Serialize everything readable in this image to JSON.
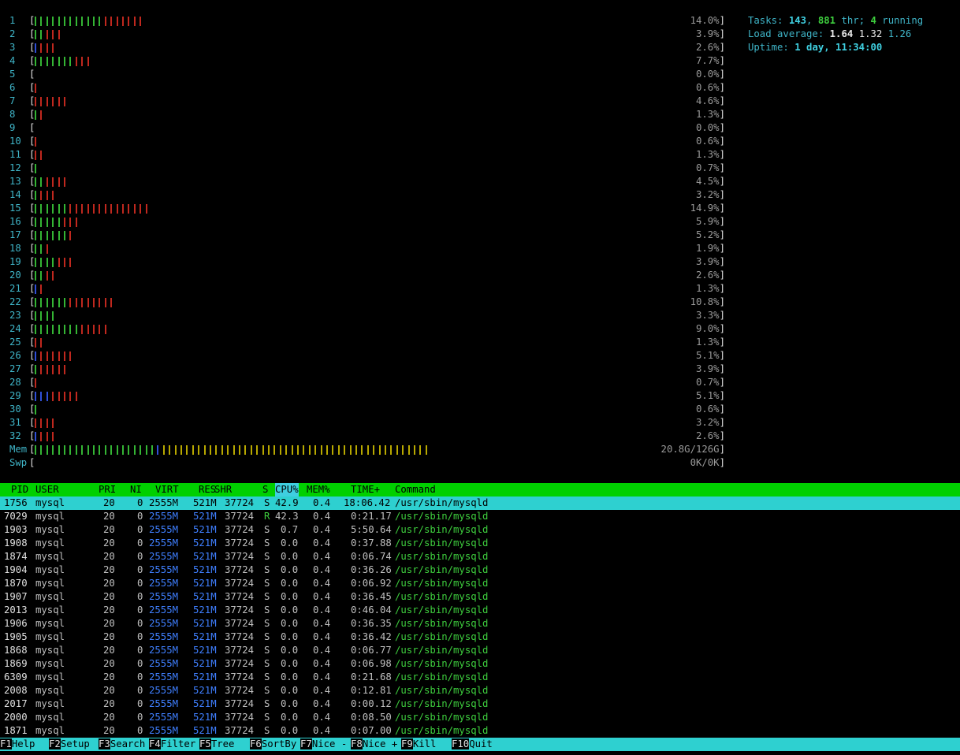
{
  "colors": {
    "normal_bar": "#34b534",
    "kernel_bar": "#c0281e",
    "low_bar": "#3050d8",
    "buffer_bar": "#b8a800",
    "accent": "#2ed0d0",
    "header_bg": "#00d000"
  },
  "meters": {
    "cpus": [
      {
        "id": "1",
        "percent": "14.0%",
        "segments": [
          [
            "g",
            12
          ],
          [
            "r",
            7
          ]
        ]
      },
      {
        "id": "2",
        "percent": "3.9%",
        "segments": [
          [
            "g",
            2
          ],
          [
            "r",
            3
          ]
        ]
      },
      {
        "id": "3",
        "percent": "2.6%",
        "segments": [
          [
            "b",
            1
          ],
          [
            "r",
            3
          ]
        ]
      },
      {
        "id": "4",
        "percent": "7.7%",
        "segments": [
          [
            "g",
            7
          ],
          [
            "r",
            3
          ]
        ]
      },
      {
        "id": "5",
        "percent": "0.0%",
        "segments": []
      },
      {
        "id": "6",
        "percent": "0.6%",
        "segments": [
          [
            "r",
            1
          ]
        ]
      },
      {
        "id": "7",
        "percent": "4.6%",
        "segments": [
          [
            "r",
            6
          ]
        ]
      },
      {
        "id": "8",
        "percent": "1.3%",
        "segments": [
          [
            "g",
            1
          ],
          [
            "r",
            1
          ]
        ]
      },
      {
        "id": "9",
        "percent": "0.0%",
        "segments": []
      },
      {
        "id": "10",
        "percent": "0.6%",
        "segments": [
          [
            "r",
            1
          ]
        ]
      },
      {
        "id": "11",
        "percent": "1.3%",
        "segments": [
          [
            "r",
            2
          ]
        ]
      },
      {
        "id": "12",
        "percent": "0.7%",
        "segments": [
          [
            "g",
            1
          ]
        ]
      },
      {
        "id": "13",
        "percent": "4.5%",
        "segments": [
          [
            "g",
            2
          ],
          [
            "r",
            4
          ]
        ]
      },
      {
        "id": "14",
        "percent": "3.2%",
        "segments": [
          [
            "g",
            1
          ],
          [
            "r",
            3
          ]
        ]
      },
      {
        "id": "15",
        "percent": "14.9%",
        "segments": [
          [
            "g",
            6
          ],
          [
            "r",
            14
          ]
        ]
      },
      {
        "id": "16",
        "percent": "5.9%",
        "segments": [
          [
            "g",
            5
          ],
          [
            "r",
            3
          ]
        ]
      },
      {
        "id": "17",
        "percent": "5.2%",
        "segments": [
          [
            "g",
            6
          ],
          [
            "r",
            1
          ]
        ]
      },
      {
        "id": "18",
        "percent": "1.9%",
        "segments": [
          [
            "g",
            2
          ],
          [
            "r",
            1
          ]
        ]
      },
      {
        "id": "19",
        "percent": "3.9%",
        "segments": [
          [
            "g",
            4
          ],
          [
            "r",
            3
          ]
        ]
      },
      {
        "id": "20",
        "percent": "2.6%",
        "segments": [
          [
            "g",
            2
          ],
          [
            "r",
            2
          ]
        ]
      },
      {
        "id": "21",
        "percent": "1.3%",
        "segments": [
          [
            "b",
            1
          ],
          [
            "r",
            1
          ]
        ]
      },
      {
        "id": "22",
        "percent": "10.8%",
        "segments": [
          [
            "g",
            6
          ],
          [
            "r",
            8
          ]
        ]
      },
      {
        "id": "23",
        "percent": "3.3%",
        "segments": [
          [
            "g",
            4
          ]
        ]
      },
      {
        "id": "24",
        "percent": "9.0%",
        "segments": [
          [
            "g",
            8
          ],
          [
            "r",
            5
          ]
        ]
      },
      {
        "id": "25",
        "percent": "1.3%",
        "segments": [
          [
            "r",
            2
          ]
        ]
      },
      {
        "id": "26",
        "percent": "5.1%",
        "segments": [
          [
            "b",
            1
          ],
          [
            "r",
            6
          ]
        ]
      },
      {
        "id": "27",
        "percent": "3.9%",
        "segments": [
          [
            "g",
            1
          ],
          [
            "r",
            5
          ]
        ]
      },
      {
        "id": "28",
        "percent": "0.7%",
        "segments": [
          [
            "r",
            1
          ]
        ]
      },
      {
        "id": "29",
        "percent": "5.1%",
        "segments": [
          [
            "b",
            3
          ],
          [
            "r",
            5
          ]
        ]
      },
      {
        "id": "30",
        "percent": "0.6%",
        "segments": [
          [
            "g",
            1
          ]
        ]
      },
      {
        "id": "31",
        "percent": "3.2%",
        "segments": [
          [
            "r",
            4
          ]
        ]
      },
      {
        "id": "32",
        "percent": "2.6%",
        "segments": [
          [
            "b",
            1
          ],
          [
            "r",
            3
          ]
        ]
      }
    ],
    "mem": {
      "label": "Mem",
      "value": "20.8G/126G",
      "segments": [
        [
          "g",
          21
        ],
        [
          "b",
          1
        ],
        [
          "y",
          46
        ]
      ]
    },
    "swap": {
      "label": "Swp",
      "value": "0K/0K",
      "segments": []
    }
  },
  "summary": {
    "tasks_label": "Tasks: ",
    "tasks": "143",
    "sep1": ", ",
    "threads": "881",
    "thr_label": " thr; ",
    "running": "4",
    "running_label": " running",
    "load_label": "Load average: ",
    "load1": "1.64",
    "load5": "1.32",
    "load15": "1.26",
    "uptime_label": "Uptime: ",
    "uptime": "1 day, 11:34:00"
  },
  "table": {
    "columns": [
      "PID",
      "USER",
      "PRI",
      "NI",
      "VIRT",
      "RES",
      "SHR",
      "S",
      "CPU%",
      "MEM%",
      "TIME+",
      "Command"
    ],
    "rows": [
      [
        "1756",
        "mysql",
        "20",
        "0",
        "2555M",
        "521M",
        "37724",
        "S",
        "42.9",
        "0.4",
        "18:06.42",
        "/usr/sbin/mysqld"
      ],
      [
        "7029",
        "mysql",
        "20",
        "0",
        "2555M",
        "521M",
        "37724",
        "R",
        "42.3",
        "0.4",
        "0:21.17",
        "/usr/sbin/mysqld"
      ],
      [
        "1903",
        "mysql",
        "20",
        "0",
        "2555M",
        "521M",
        "37724",
        "S",
        "0.7",
        "0.4",
        "5:50.64",
        "/usr/sbin/mysqld"
      ],
      [
        "1908",
        "mysql",
        "20",
        "0",
        "2555M",
        "521M",
        "37724",
        "S",
        "0.0",
        "0.4",
        "0:37.88",
        "/usr/sbin/mysqld"
      ],
      [
        "1874",
        "mysql",
        "20",
        "0",
        "2555M",
        "521M",
        "37724",
        "S",
        "0.0",
        "0.4",
        "0:06.74",
        "/usr/sbin/mysqld"
      ],
      [
        "1904",
        "mysql",
        "20",
        "0",
        "2555M",
        "521M",
        "37724",
        "S",
        "0.0",
        "0.4",
        "0:36.26",
        "/usr/sbin/mysqld"
      ],
      [
        "1870",
        "mysql",
        "20",
        "0",
        "2555M",
        "521M",
        "37724",
        "S",
        "0.0",
        "0.4",
        "0:06.92",
        "/usr/sbin/mysqld"
      ],
      [
        "1907",
        "mysql",
        "20",
        "0",
        "2555M",
        "521M",
        "37724",
        "S",
        "0.0",
        "0.4",
        "0:36.45",
        "/usr/sbin/mysqld"
      ],
      [
        "2013",
        "mysql",
        "20",
        "0",
        "2555M",
        "521M",
        "37724",
        "S",
        "0.0",
        "0.4",
        "0:46.04",
        "/usr/sbin/mysqld"
      ],
      [
        "1906",
        "mysql",
        "20",
        "0",
        "2555M",
        "521M",
        "37724",
        "S",
        "0.0",
        "0.4",
        "0:36.35",
        "/usr/sbin/mysqld"
      ],
      [
        "1905",
        "mysql",
        "20",
        "0",
        "2555M",
        "521M",
        "37724",
        "S",
        "0.0",
        "0.4",
        "0:36.42",
        "/usr/sbin/mysqld"
      ],
      [
        "1868",
        "mysql",
        "20",
        "0",
        "2555M",
        "521M",
        "37724",
        "S",
        "0.0",
        "0.4",
        "0:06.77",
        "/usr/sbin/mysqld"
      ],
      [
        "1869",
        "mysql",
        "20",
        "0",
        "2555M",
        "521M",
        "37724",
        "S",
        "0.0",
        "0.4",
        "0:06.98",
        "/usr/sbin/mysqld"
      ],
      [
        "6309",
        "mysql",
        "20",
        "0",
        "2555M",
        "521M",
        "37724",
        "S",
        "0.0",
        "0.4",
        "0:21.68",
        "/usr/sbin/mysqld"
      ],
      [
        "2008",
        "mysql",
        "20",
        "0",
        "2555M",
        "521M",
        "37724",
        "S",
        "0.0",
        "0.4",
        "0:12.81",
        "/usr/sbin/mysqld"
      ],
      [
        "2017",
        "mysql",
        "20",
        "0",
        "2555M",
        "521M",
        "37724",
        "S",
        "0.0",
        "0.4",
        "0:00.12",
        "/usr/sbin/mysqld"
      ],
      [
        "2000",
        "mysql",
        "20",
        "0",
        "2555M",
        "521M",
        "37724",
        "S",
        "0.0",
        "0.4",
        "0:08.50",
        "/usr/sbin/mysqld"
      ],
      [
        "1871",
        "mysql",
        "20",
        "0",
        "2555M",
        "521M",
        "37724",
        "S",
        "0.0",
        "0.4",
        "0:07.00",
        "/usr/sbin/mysqld"
      ]
    ]
  },
  "footer": [
    {
      "key": "F1",
      "label": "Help  "
    },
    {
      "key": "F2",
      "label": "Setup "
    },
    {
      "key": "F3",
      "label": "Search"
    },
    {
      "key": "F4",
      "label": "Filter"
    },
    {
      "key": "F5",
      "label": "Tree  "
    },
    {
      "key": "F6",
      "label": "SortBy"
    },
    {
      "key": "F7",
      "label": "Nice -"
    },
    {
      "key": "F8",
      "label": "Nice +"
    },
    {
      "key": "F9",
      "label": "Kill  "
    },
    {
      "key": "F10",
      "label": "Quit  "
    }
  ]
}
